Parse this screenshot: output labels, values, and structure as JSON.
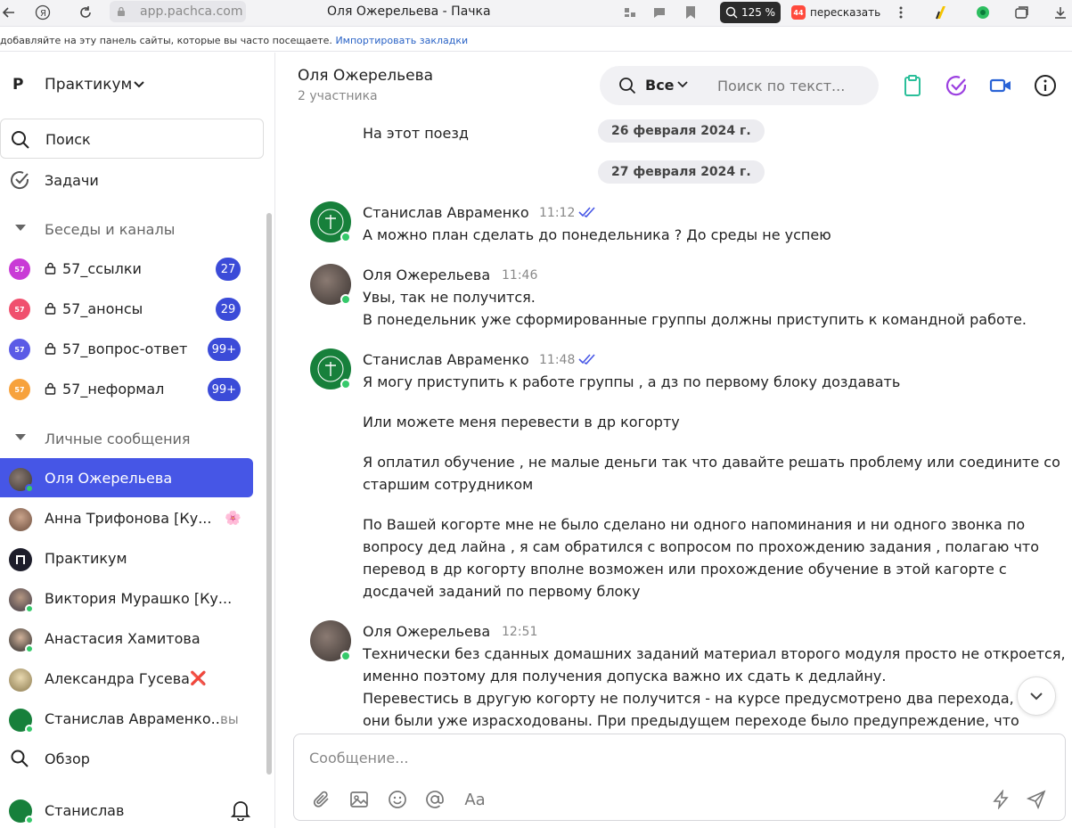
{
  "browser": {
    "url": "app.pachca.com",
    "tab_title": "Оля Ожерельева - Пачка",
    "zoom": "125 %",
    "summarize_label": "пересказать",
    "summarize_badge": "44",
    "bookmarks_prompt": "добавляйте на эту панель сайты, которые вы часто посещаете.",
    "bookmarks_import": "Импортировать закладки"
  },
  "sidebar": {
    "workspace_logo": "P",
    "workspace_name": "Практикум",
    "search_label": "Поиск",
    "tasks_label": "Задачи",
    "channels_section": "Беседы и каналы",
    "channels": [
      {
        "avatar": "57",
        "name": "57_ссылки",
        "badge": "27",
        "color": "#c93bd6"
      },
      {
        "avatar": "57",
        "name": "57_анонсы",
        "badge": "29",
        "color": "#f0506e"
      },
      {
        "avatar": "57",
        "name": "57_вопрос-ответ",
        "badge": "99+",
        "color": "#5b5be6"
      },
      {
        "avatar": "57",
        "name": "57_неформал",
        "badge": "99+",
        "color": "#f7a23c"
      }
    ],
    "dm_section": "Личные сообщения",
    "dms": [
      {
        "name": "Оля Ожерельева",
        "extra": ""
      },
      {
        "name": "Анна Трифонова [Ку...",
        "extra": "🌸"
      },
      {
        "name": "Практикум",
        "extra": ""
      },
      {
        "name": "Виктория Мурашко [Ку...",
        "extra": ""
      },
      {
        "name": "Анастасия Хамитова",
        "extra": ""
      },
      {
        "name": "Александра Гусева",
        "extra": "❌"
      },
      {
        "name": "Станислав Авраменко...",
        "extra": "вы"
      }
    ],
    "overview_label": "Обзор",
    "user_name": "Станислав"
  },
  "chat": {
    "title": "Оля Ожерельева",
    "subtitle": "2 участника",
    "search_filter": "Все",
    "search_placeholder": "Поиск по текст...",
    "prev_line": "На этот поезд",
    "dates": [
      "26 февраля 2024 г.",
      "27 февраля 2024 г."
    ],
    "messages": [
      {
        "author": "Станислав Авраменко",
        "time": "11:12",
        "read": true,
        "lines": [
          "А можно план сделать до понедельника ? До среды не успею"
        ]
      },
      {
        "author": "Оля Ожерельева",
        "time": "11:46",
        "read": false,
        "lines": [
          "Увы, так не получится.",
          "В понедельник уже сформированные  группы должны приступить к командной работе."
        ]
      },
      {
        "author": "Станислав Авраменко",
        "time": "11:48",
        "read": true,
        "lines": [
          "Я могу приступить к работе группы , а дз по первому блоку доздавать",
          "",
          "Или можете меня перевести в др когорту",
          "",
          "Я оплатил обучение , не малые деньги так что давайте решать проблему или соедините со",
          "старшим сотрудником",
          "",
          "По Вашей когорте мне не было сделано ни одного напоминания и ни одного звонка по",
          "вопросу дед лайна , я сам обратился с вопросом по прохождению задания , полагаю что",
          "перевод в др когорту вполне возможен или прохождение обучение в этой кагорте с",
          "досдачей заданий по первому блоку"
        ]
      },
      {
        "author": "Оля Ожерельева",
        "time": "12:51",
        "read": false,
        "lines": [
          "Технически без сданных домашних заданий материал второго модуля просто не откроется,",
          "именно поэтому для получения допуска важно их сдать к дедлайну.",
          "Перевестись в другую когорту не получится - на курсе предусмотрено два перехода, у т",
          "они были уже израсходованы. При предыдущем переходе было предупреждение, что"
        ]
      }
    ],
    "composer_placeholder": "Сообщение..."
  },
  "colors": {
    "accent": "#4656e6",
    "badge": "#3b4bd8",
    "online": "#35c96a",
    "clipboard_icon": "#2bbf9a",
    "tasks_icon": "#9b3fe0",
    "video_icon": "#2a63d6"
  }
}
